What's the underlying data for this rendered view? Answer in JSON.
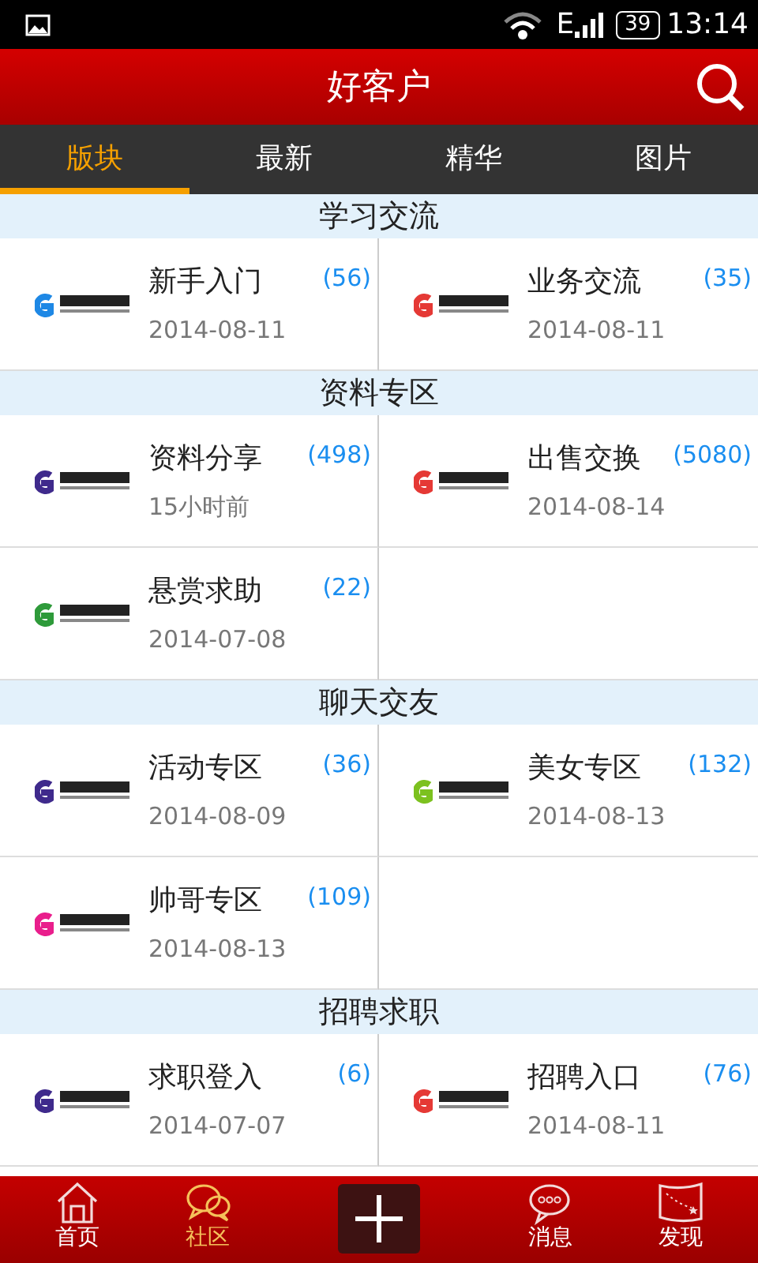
{
  "status_bar": {
    "network": "E",
    "battery": "39",
    "time": "13:14"
  },
  "app_bar": {
    "title": "好客户"
  },
  "tabs": [
    {
      "label": "版块",
      "selected": true
    },
    {
      "label": "最新",
      "selected": false
    },
    {
      "label": "精华",
      "selected": false
    },
    {
      "label": "图片",
      "selected": false
    }
  ],
  "sections": [
    {
      "title": "学习交流",
      "forums": [
        {
          "name": "新手入门",
          "count": "(56)",
          "date": "2014-08-11",
          "color": "#1e88e5"
        },
        {
          "name": "业务交流",
          "count": "(35)",
          "date": "2014-08-11",
          "color": "#e53935"
        }
      ]
    },
    {
      "title": "资料专区",
      "forums": [
        {
          "name": "资料分享",
          "count": "(498)",
          "date": "15小时前",
          "color": "#3f2a8c"
        },
        {
          "name": "出售交换",
          "count": "(5080)",
          "date": "2014-08-14",
          "color": "#e53935"
        },
        {
          "name": "悬赏求助",
          "count": "(22)",
          "date": "2014-07-08",
          "color": "#2e9a3a"
        }
      ]
    },
    {
      "title": "聊天交友",
      "forums": [
        {
          "name": "活动专区",
          "count": "(36)",
          "date": "2014-08-09",
          "color": "#3f2a8c"
        },
        {
          "name": "美女专区",
          "count": "(132)",
          "date": "2014-08-13",
          "color": "#7cc11f"
        },
        {
          "name": "帅哥专区",
          "count": "(109)",
          "date": "2014-08-13",
          "color": "#e91e8c"
        }
      ]
    },
    {
      "title": "招聘求职",
      "forums": [
        {
          "name": "求职登入",
          "count": "(6)",
          "date": "2014-07-07",
          "color": "#3f2a8c"
        },
        {
          "name": "招聘入口",
          "count": "(76)",
          "date": "2014-08-11",
          "color": "#e53935"
        }
      ]
    }
  ],
  "bottom_nav": [
    {
      "kind": "home",
      "label": "首页",
      "selected": false
    },
    {
      "kind": "chat",
      "label": "社区",
      "selected": true
    },
    {
      "kind": "add"
    },
    {
      "kind": "message",
      "label": "消息",
      "selected": false
    },
    {
      "kind": "map",
      "label": "发现",
      "selected": false
    }
  ]
}
